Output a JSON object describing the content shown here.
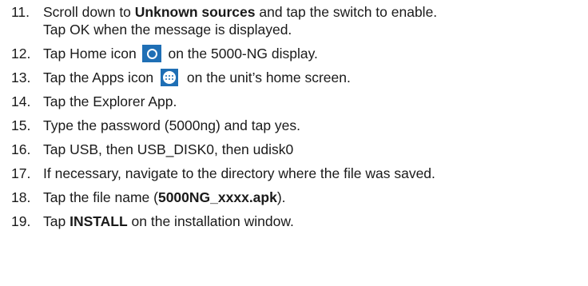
{
  "steps": [
    {
      "number": "11.",
      "line1_pre": "Scroll down to ",
      "line1_bold": "Unknown sources",
      "line1_post": " and tap the switch to enable.",
      "line2": "Tap OK when the message is displayed."
    },
    {
      "number": "12.",
      "pre": "Tap Home icon",
      "icon": "home-circle-icon",
      "post": "on the 5000-NG display."
    },
    {
      "number": "13.",
      "pre": "Tap the Apps icon",
      "icon": "apps-grid-icon",
      "post": "on the unit’s home screen."
    },
    {
      "number": "14.",
      "text": "Tap the Explorer App."
    },
    {
      "number": "15.",
      "text": "Type the password (5000ng) and tap yes."
    },
    {
      "number": "16.",
      "text": "Tap USB, then USB_DISK0, then udisk0"
    },
    {
      "number": "17.",
      "text": "If necessary, navigate to the directory where the file was saved."
    },
    {
      "number": "18.",
      "pre": "Tap the file name (",
      "bold": "5000NG_xxxx.apk",
      "post": ")."
    },
    {
      "number": "19.",
      "pre": "Tap ",
      "bold": "INSTALL",
      "post": " on the installation window."
    }
  ],
  "colors": {
    "icon_blue": "#1f6fb5",
    "text": "#1a1a1a"
  }
}
